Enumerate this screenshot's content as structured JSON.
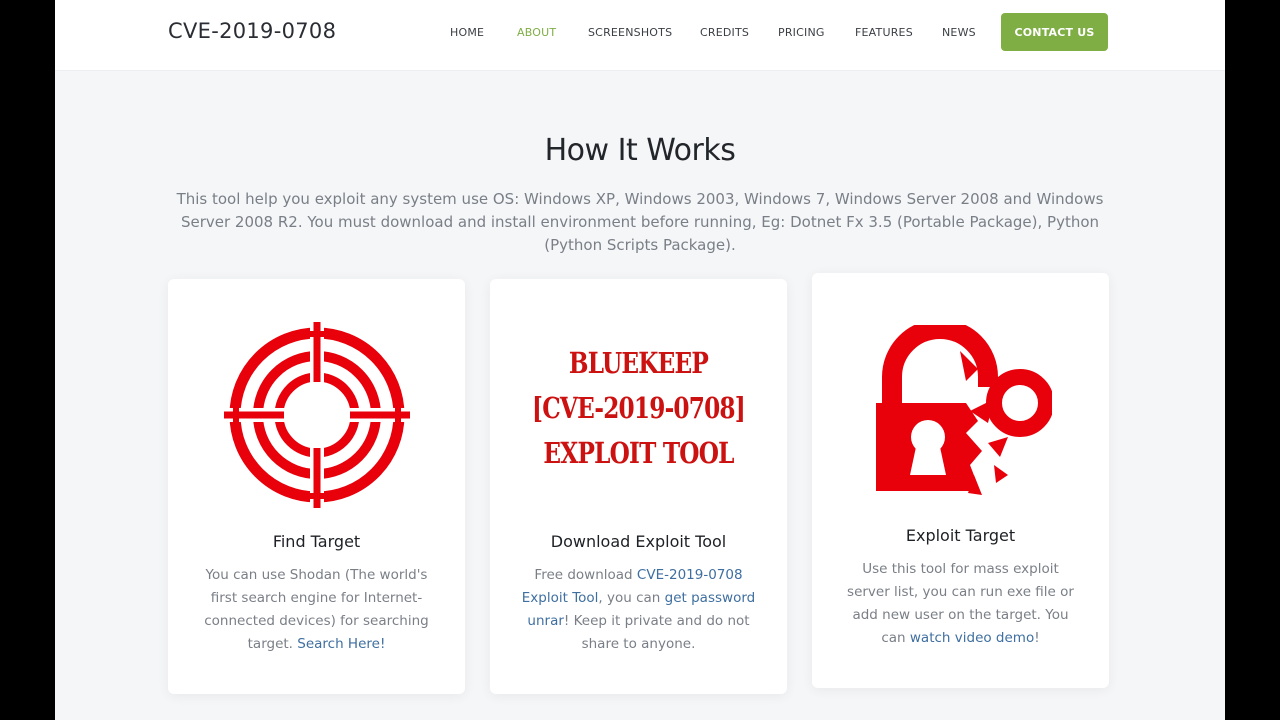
{
  "brand": "CVE-2019-0708",
  "nav": {
    "items": [
      "HOME",
      "ABOUT",
      "SCREENSHOTS",
      "CREDITS",
      "PRICING",
      "FEATURES",
      "NEWS"
    ],
    "active": "ABOUT",
    "cta": "CONTACT US"
  },
  "section": {
    "title": "How It Works",
    "description": "This tool help you exploit any system use OS: Windows XP, Windows 2003, Windows 7, Windows Server 2008 and Windows Server 2008 R2. You must download and install environment before running, Eg: Dotnet Fx 3.5 (Portable Package), Python (Python Scripts Package)."
  },
  "cards": [
    {
      "title": "Find Target",
      "icon": "crosshair-target-icon",
      "text_before": "You can use Shodan (The world's first search engine for Internet-connected devices) for searching target. ",
      "link": "Search Here!"
    },
    {
      "title": "Download Exploit Tool",
      "image_lines": [
        "BLUEKEEP",
        "[CVE-2019-0708]",
        "EXPLOIT TOOL"
      ],
      "text_1": "Free download ",
      "link_1": "CVE-2019-0708 Exploit Tool",
      "text_2": ", you can ",
      "link_2": "get password unrar",
      "text_3": "! Keep it private and do not share to anyone."
    },
    {
      "title": "Exploit Target",
      "icon": "broken-padlock-icon",
      "text_before": "Use this tool for mass exploit server list, you can run exe file or add new user on the target. You can ",
      "link": "watch video demo",
      "text_after": "!"
    }
  ],
  "colors": {
    "accent": "#7fae44",
    "link": "#3f6fa0",
    "illustration": "#e8000b"
  }
}
